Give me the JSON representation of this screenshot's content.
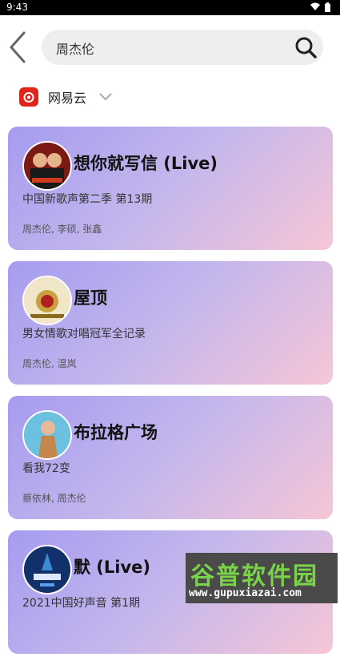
{
  "status": {
    "time": "9:43"
  },
  "search": {
    "value": "周杰伦"
  },
  "source": {
    "name": "网易云"
  },
  "colors": {
    "accent": "#e2231a",
    "card_start": "#a59cf0",
    "card_end": "#f6c6d6"
  },
  "results": [
    {
      "title": "想你就写信 (Live)",
      "album": "中国新歌声第二季 第13期",
      "artists": "周杰伦, 李硕, 张鑫"
    },
    {
      "title": "屋顶",
      "album": "男女情歌对唱冠军全记录",
      "artists": "周杰伦, 温岚"
    },
    {
      "title": "布拉格广场",
      "album": "看我72变",
      "artists": "蔡依林, 周杰伦"
    },
    {
      "title": "默 (Live)",
      "album": "2021中国好声音 第1期",
      "artists": ""
    }
  ],
  "watermark": {
    "title": "谷普软件园",
    "url": "www.gupuxiazai.com"
  }
}
